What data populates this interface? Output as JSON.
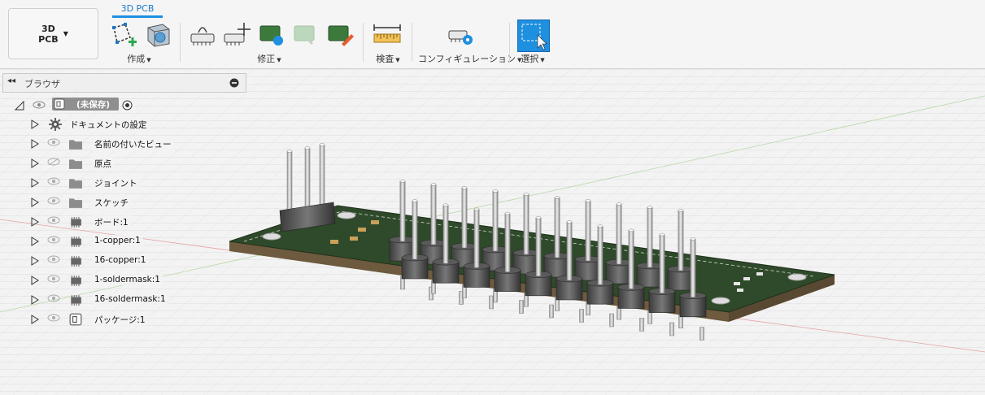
{
  "workspace": {
    "label": "3D\nPCB",
    "caret": "▾"
  },
  "tab": {
    "label": "3D PCB"
  },
  "groups": {
    "create": "作成",
    "modify": "修正",
    "inspect": "検査",
    "configure": "コンフィギュレーション",
    "select": "選択"
  },
  "browser": {
    "title": "ブラウザ",
    "root": "(未保存)",
    "items": [
      {
        "label": "ドキュメントの設定",
        "icon": "gear-icon"
      },
      {
        "label": "名前の付いたビュー",
        "icon": "folder-icon"
      },
      {
        "label": "原点",
        "icon": "folder-icon",
        "hidden": true
      },
      {
        "label": "ジョイント",
        "icon": "folder-icon"
      },
      {
        "label": "スケッチ",
        "icon": "folder-icon"
      },
      {
        "label": "ボード:1",
        "icon": "chip-icon"
      },
      {
        "label": "1-copper:1",
        "icon": "chip-icon"
      },
      {
        "label": "16-copper:1",
        "icon": "chip-icon"
      },
      {
        "label": "1-soldermask:1",
        "icon": "chip-icon"
      },
      {
        "label": "16-soldermask:1",
        "icon": "chip-icon"
      },
      {
        "label": "パッケージ:1",
        "icon": "component-icon"
      }
    ]
  }
}
